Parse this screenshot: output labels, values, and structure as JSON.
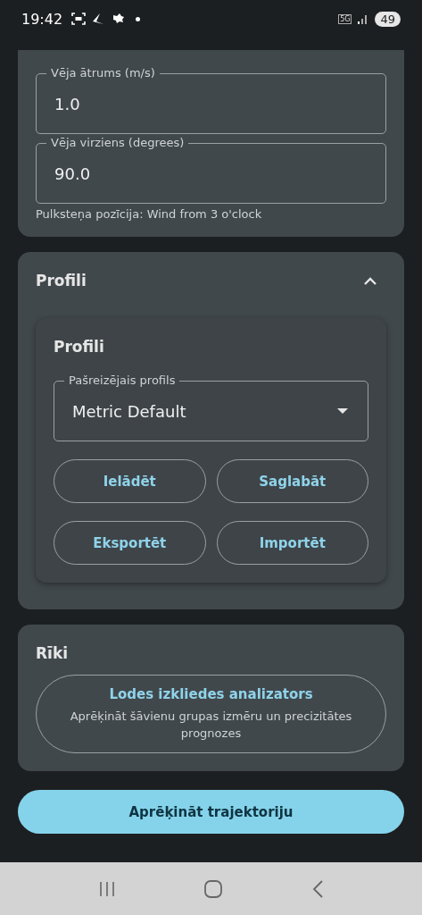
{
  "status_bar": {
    "time": "19:42",
    "network": "5G",
    "battery": "49"
  },
  "wind": {
    "fields": [
      {
        "label": "Vēja ātrums (m/s)",
        "value": "1.0"
      },
      {
        "label": "Vēja virziens (degrees)",
        "value": "90.0"
      }
    ],
    "note": "Pulksteņa pozīcija: Wind from 3 o'clock"
  },
  "profiles_section": {
    "title": "Profili",
    "expanded": true,
    "card_title": "Profili",
    "select": {
      "label": "Pašreizējais profils",
      "value": "Metric Default"
    },
    "buttons": [
      "Ielādēt",
      "Saglabāt",
      "Eksportēt",
      "Importēt"
    ]
  },
  "tools": {
    "title": "Rīki",
    "tool": {
      "title": "Lodes izkliedes analizators",
      "description": "Aprēķināt šāvienu grupas izmēru un precizitātes prognozes"
    }
  },
  "calculate_button": "Aprēķināt trajektoriju"
}
